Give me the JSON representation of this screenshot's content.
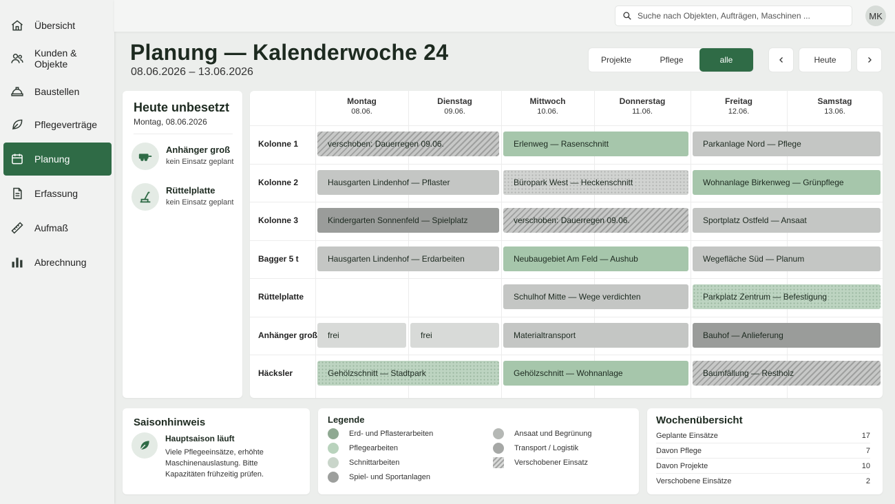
{
  "sidebar": {
    "items": [
      {
        "label": "Übersicht",
        "icon": "home-icon"
      },
      {
        "label": "Kunden & Objekte",
        "icon": "users-icon"
      },
      {
        "label": "Baustellen",
        "icon": "helmet-icon"
      },
      {
        "label": "Pflegeverträge",
        "icon": "leaf-icon"
      },
      {
        "label": "Planung",
        "icon": "calendar-icon",
        "active": true
      },
      {
        "label": "Erfassung",
        "icon": "document-icon"
      },
      {
        "label": "Aufmaß",
        "icon": "ruler-icon"
      },
      {
        "label": "Abrechnung",
        "icon": "bar-chart-icon"
      }
    ]
  },
  "topbar": {
    "search_placeholder": "Suche nach Objekten, Aufträgen, Maschinen ...",
    "avatar_initials": "MK"
  },
  "header": {
    "title": "Planung — Kalenderwoche 24",
    "range": "08.06.2026 – 13.06.2026"
  },
  "filters": {
    "options": [
      "Projekte",
      "Pflege",
      "alle"
    ],
    "active": "alle",
    "today_label": "Heute"
  },
  "unused": {
    "title": "Heute unbesetzt",
    "date": "Montag, 08.06.2026",
    "machines": [
      {
        "name": "Anhänger groß",
        "status": "kein Einsatz geplant",
        "icon": "trailer-icon"
      },
      {
        "name": "Rüttelplatte",
        "status": "kein Einsatz geplant",
        "icon": "compactor-icon"
      }
    ]
  },
  "calendar": {
    "days": [
      {
        "name": "Montag",
        "date": "08.06."
      },
      {
        "name": "Dienstag",
        "date": "09.06."
      },
      {
        "name": "Mittwoch",
        "date": "10.06."
      },
      {
        "name": "Donnerstag",
        "date": "11.06."
      },
      {
        "name": "Freitag",
        "date": "12.06."
      },
      {
        "name": "Samstag",
        "date": "13.06."
      }
    ],
    "rows": [
      {
        "label": "Kolonne 1",
        "events": [
          {
            "text": "verschoben: Dauerregen 09.06.",
            "start": 0,
            "span": 2,
            "style": "shift"
          },
          {
            "text": "Erlenweg — Rasenschnitt",
            "start": 2,
            "span": 2,
            "style": "green"
          },
          {
            "text": "Parkanlage Nord — Pflege",
            "start": 4,
            "span": 2,
            "style": "gray"
          }
        ]
      },
      {
        "label": "Kolonne 2",
        "events": [
          {
            "text": "Hausgarten Lindenhof — Pflaster",
            "start": 0,
            "span": 2,
            "style": "gray"
          },
          {
            "text": "Büropark West — Heckenschnitt",
            "start": 2,
            "span": 2,
            "style": "dots"
          },
          {
            "text": "Wohnanlage Birkenweg — Grünpflege",
            "start": 4,
            "span": 2,
            "style": "green"
          }
        ]
      },
      {
        "label": "Kolonne 3",
        "events": [
          {
            "text": "Kindergarten Sonnenfeld — Spielplatz",
            "start": 0,
            "span": 2,
            "style": "dark"
          },
          {
            "text": "verschoben: Dauerregen 09.06.",
            "start": 2,
            "span": 2,
            "style": "shift"
          },
          {
            "text": "Sportplatz Ostfeld — Ansaat",
            "start": 4,
            "span": 2,
            "style": "gray"
          }
        ]
      },
      {
        "label": "Bagger 5 t",
        "events": [
          {
            "text": "Hausgarten Lindenhof — Erdarbeiten",
            "start": 0,
            "span": 2,
            "style": "gray"
          },
          {
            "text": "Neubaugebiet Am Feld — Aushub",
            "start": 2,
            "span": 2,
            "style": "green"
          },
          {
            "text": "Wegefläche Süd — Planum",
            "start": 4,
            "span": 2,
            "style": "gray"
          }
        ]
      },
      {
        "label": "Rüttelplatte",
        "events": [
          {
            "text": "Schulhof Mitte — Wege verdichten",
            "start": 2,
            "span": 2,
            "style": "gray"
          },
          {
            "text": "Parkplatz Zentrum — Befestigung",
            "start": 4,
            "span": 2,
            "style": "dotsg"
          }
        ]
      },
      {
        "label": "Anhänger groß",
        "events": [
          {
            "text": "frei",
            "start": 0,
            "span": 1,
            "style": "free"
          },
          {
            "text": "frei",
            "start": 1,
            "span": 1,
            "style": "free"
          },
          {
            "text": "Materialtransport",
            "start": 2,
            "span": 2,
            "style": "gray"
          },
          {
            "text": "Bauhof — Anlieferung",
            "start": 4,
            "span": 2,
            "style": "dark"
          }
        ]
      },
      {
        "label": "Häcksler",
        "events": [
          {
            "text": "Gehölzschnitt — Stadtpark",
            "start": 0,
            "span": 2,
            "style": "dotsg"
          },
          {
            "text": "Gehölzschnitt — Wohnanlage",
            "start": 2,
            "span": 2,
            "style": "green"
          },
          {
            "text": "Baumfällung — Restholz",
            "start": 4,
            "span": 2,
            "style": "shift"
          }
        ]
      }
    ]
  },
  "season": {
    "title": "Saisonhinweis",
    "heading": "Hauptsaison läuft",
    "text": "Viele Pflegeeinsätze, erhöhte Maschinenauslastung. Bitte Kapazitäten frühzeitig prüfen."
  },
  "legend": {
    "title": "Legende",
    "items": [
      {
        "label": "Erd- und Pflasterarbeiten",
        "color": "#8fa992",
        "kind": "dot"
      },
      {
        "label": "Pflegearbeiten",
        "color": "#b9d3bd",
        "kind": "dot"
      },
      {
        "label": "Schnittarbeiten",
        "color": "#c9d5ca",
        "kind": "dot"
      },
      {
        "label": "Spiel- und Sportanlagen",
        "color": "#9d9f9d",
        "kind": "dot"
      },
      {
        "label": "Ansaat und Begrünung",
        "color": "#b5b8b5",
        "kind": "dot"
      },
      {
        "label": "Transport / Logistik",
        "color": "#a6a8a6",
        "kind": "dot"
      },
      {
        "label": "Verschobener Einsatz",
        "color": "#b8b9b8",
        "kind": "hatch"
      }
    ]
  },
  "summary": {
    "title": "Wochenübersicht",
    "rows": [
      {
        "label": "Geplante Einsätze",
        "value": "17"
      },
      {
        "label": "Davon Pflege",
        "value": "7"
      },
      {
        "label": "Davon Projekte",
        "value": "10"
      },
      {
        "label": "Verschobene Einsätze",
        "value": "2"
      }
    ]
  }
}
